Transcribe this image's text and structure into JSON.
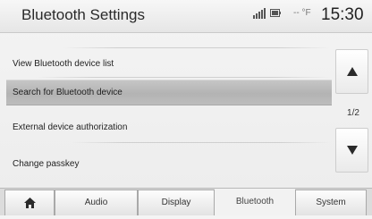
{
  "header": {
    "title": "Bluetooth Settings",
    "signal_icon": "signal-bars-icon",
    "phone_icon": "phone-battery-icon",
    "temperature": "-- °F",
    "time": "15:30"
  },
  "menu": {
    "items": [
      {
        "label": "View Bluetooth device list",
        "selected": false
      },
      {
        "label": "Search for Bluetooth device",
        "selected": true
      },
      {
        "label": "External device authorization",
        "selected": false
      },
      {
        "label": "Change passkey",
        "selected": false
      }
    ]
  },
  "scroll": {
    "up_icon": "triangle-up-icon",
    "down_icon": "triangle-down-icon",
    "page_indicator": "1/2"
  },
  "tabs": {
    "home_icon": "home-icon",
    "items": [
      {
        "label": "Audio",
        "active": false
      },
      {
        "label": "Display",
        "active": false
      },
      {
        "label": "Bluetooth",
        "active": true
      },
      {
        "label": "System",
        "active": false
      }
    ]
  }
}
